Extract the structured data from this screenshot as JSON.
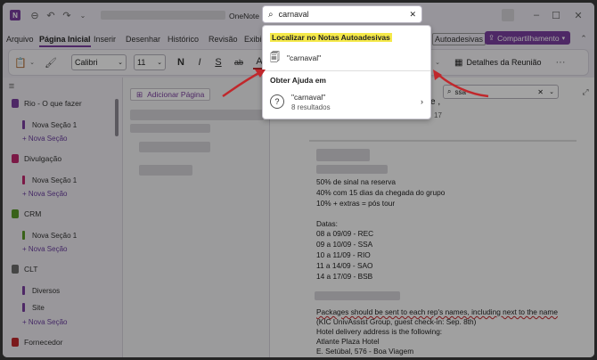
{
  "titlebar": {
    "app_name": "OneNote",
    "search_value": "carnaval",
    "window_controls": [
      "minimize-icon",
      "maximize-icon",
      "close-icon"
    ]
  },
  "menu": {
    "items": [
      "Arquivo",
      "Página Inicial",
      "Inserir",
      "Desenhar",
      "Histórico",
      "Revisão",
      "Exibir"
    ],
    "right_tab": "Autoadesivas",
    "share_label": "Compartilhamento"
  },
  "ribbon": {
    "font_name": "Calibri",
    "font_size": "11",
    "bold": "N",
    "italic": "I",
    "strike": "S",
    "strikethrough2": "ab",
    "font_color": "A",
    "meeting_details": "Detalhes da Reunião",
    "more": "···"
  },
  "search_panel": {
    "section1_title": "Localizar no Notas Autoadesivas",
    "section1_item": "\"carnaval\"",
    "section2_title": "Obter Ajuda em",
    "section2_item": "\"carnaval\"",
    "section2_count": "8 resultados"
  },
  "sidebar": {
    "notebooks": [
      {
        "name": "Rio - O que fazer",
        "color": "#7b3fa0",
        "sections": [
          "Nova Seção 1"
        ],
        "section_color": "#7b3fa0"
      },
      {
        "name": "Divulgação",
        "color": "#c0286e",
        "sections": [
          "Nova Seção 1"
        ],
        "section_color": "#c0286e"
      },
      {
        "name": "CRM",
        "color": "#5a9a2a",
        "sections": [
          "Nova Seção 1"
        ],
        "section_color": "#5a9a2a"
      },
      {
        "name": "CLT",
        "color": "#6c6c6c",
        "sections": [
          "Diversos",
          "Site"
        ],
        "section_color": "#7b3fa0"
      },
      {
        "name": "Fornecedor",
        "color": "#c0282c",
        "sections": [],
        "section_color": "#c0282c"
      }
    ],
    "new_section_label": "Nova Seção"
  },
  "pagelist": {
    "add_page_label": "Adicionar Página"
  },
  "content": {
    "find_value": "ssa",
    "page_date_fragment": "17",
    "page_title_fragment": "e ,",
    "lines": [
      "50% de sinal na reserva",
      "40% com 15 dias da chegada do grupo",
      "10% + extras = pós tour",
      "",
      "Datas:",
      "08 a 09/09 - REC",
      "09 a 10/09 - SSA",
      "10 a 11/09 - RIO",
      "11 a 14/09 - SAO",
      "14 a 17/09 - BSB"
    ],
    "lines2": [
      "Packages should be sent to each rep's names, including next to the name",
      "(KIC UnivAssist Group, guest check-in: Sep. 8th)",
      "Hotel delivery address is the following:",
      "Atlante Plaza Hotel",
      "E. Setúbal, 576 - Boa Viagem"
    ]
  },
  "colors": {
    "accent": "#7b3fa0",
    "highlight": "#f5e94a",
    "arrow": "#c0282c"
  }
}
